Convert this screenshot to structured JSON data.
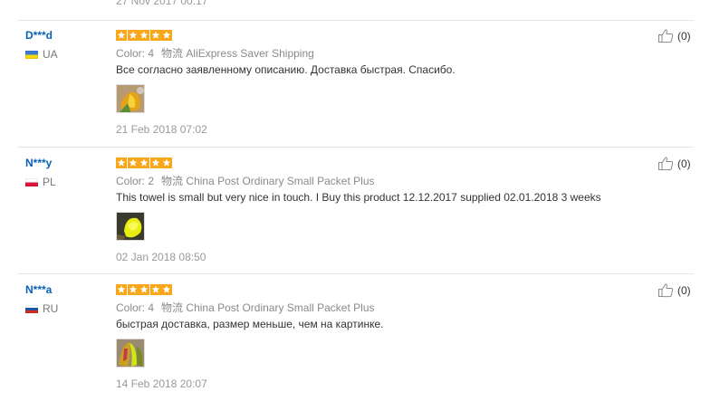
{
  "top_review": {
    "date": "27 Nov 2017 00:17"
  },
  "reviews": [
    {
      "user": "D***d",
      "country": "UA",
      "color_label": "Color:",
      "color_value": "4",
      "shipping_label": "物流",
      "shipping_method": "AliExpress Saver Shipping",
      "text": "Все согласно заявленному описанию. Доставка быстрая. Спасибо.",
      "date": "21 Feb 2018 07:02",
      "helpful": "(0)",
      "stars": 5
    },
    {
      "user": "N***y",
      "country": "PL",
      "color_label": "Color:",
      "color_value": "2",
      "shipping_label": "物流",
      "shipping_method": "China Post Ordinary Small Packet Plus",
      "text": "This towel is small but very nice in touch. I Buy this product 12.12.2017 supplied 02.01.2018 3 weeks",
      "date": "02 Jan 2018 08:50",
      "helpful": "(0)",
      "stars": 5
    },
    {
      "user": "N***a",
      "country": "RU",
      "color_label": "Color:",
      "color_value": "4",
      "shipping_label": "物流",
      "shipping_method": "China Post Ordinary Small Packet Plus",
      "text": "быстрая доставка, размер меньше, чем на картинке.",
      "date": "14 Feb 2018 20:07",
      "helpful": "(0)",
      "stars": 5
    }
  ],
  "colors": {
    "username": "#0a5fb4",
    "star": "#f8a71b",
    "meta": "#8a8a8a",
    "text": "#333333",
    "date": "#999999",
    "separator": "#e5e5e5"
  },
  "icons": {
    "rating": "star-icon",
    "helpful": "thumbs-up-icon"
  }
}
